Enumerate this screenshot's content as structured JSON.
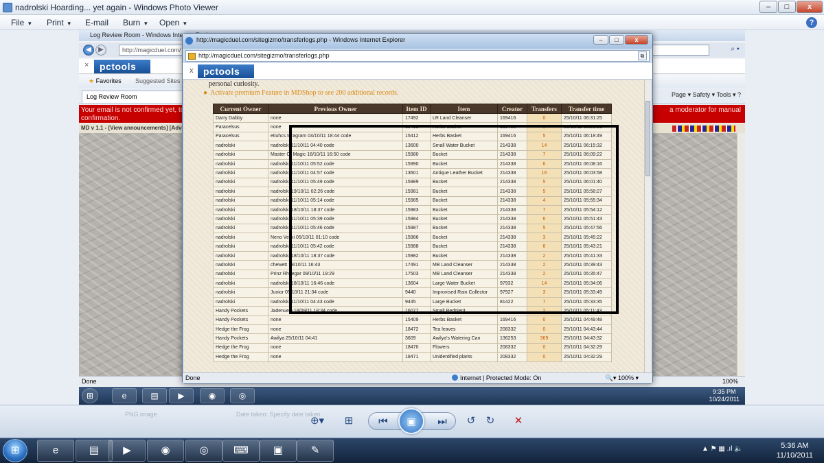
{
  "viewer": {
    "title": "nadrolski Hoarding... yet again - Windows Photo Viewer",
    "minimize": "–",
    "maximize": "□",
    "close": "x",
    "menu": [
      {
        "label": "File",
        "caret": "▼"
      },
      {
        "label": "Print",
        "caret": "▼"
      },
      {
        "label": "E-mail",
        "caret": ""
      },
      {
        "label": "Burn",
        "caret": "▼"
      },
      {
        "label": "Open",
        "caret": "▼"
      }
    ],
    "help": "?",
    "toolbar": {
      "zoom": "⊕▾",
      "fit": "⊞",
      "prev": "⏮",
      "slideshow": "▣",
      "next": "⏭",
      "rotate_left": "↺",
      "rotate_right": "↻",
      "delete": "✕",
      "ghost_left": "PNG image",
      "ghost_right": "Date taken: Specify date taken"
    }
  },
  "bg_ie": {
    "title": "Log Review Room - Windows Internet Explorer",
    "address": "http://magicduel.com/",
    "pct_label": "pctools",
    "favorites": "Favorites",
    "suggested": "Suggested Sites",
    "tab": "Log Review Room",
    "tools": "Page ▾   Safety ▾   Tools ▾   ?",
    "banner_left": "Your email is not confirmed yet, to",
    "banner_left2": "confirmation.",
    "banner_right": "a moderator for manual",
    "md_bar": "MD v 1.1 - [View announcements] [Adve",
    "status": "Done",
    "zoom": "100%",
    "clock_time": "9:35 PM",
    "clock_date": "10/24/2011"
  },
  "popup": {
    "title": "http://magicduel.com/sitegizmo/transferlogs.php - Windows Internet Explorer",
    "address": "http://magicduel.com/sitegizmo/transferlogs.php",
    "pct_label": "pctools",
    "close_tab": "x",
    "curiosity": "personal curiosity.",
    "promo": "Activate premium Feature in MDShop to see 200 additional records.",
    "status": "Done",
    "mode": "Internet | Protected Mode: On",
    "zoom": "100%"
  },
  "table": {
    "headers": [
      "Current Owner",
      "Previous Owner",
      "Item ID",
      "Item",
      "Creator",
      "Transfers",
      "Transfer time"
    ],
    "rows": [
      [
        "Darry Dabby",
        "none",
        "17492",
        "LR Land Cleanser",
        "169416",
        "0",
        "25/10/11 06:31:25"
      ],
      [
        "Paracelsus",
        "none",
        "15413",
        "Herbs Basket",
        "169416",
        "0",
        "25/10/11 06:20:31"
      ],
      [
        "Paracelsus",
        "etiuhcs teragram 04/10/11 18:44 code",
        "15412",
        "Herbs Basket",
        "169416",
        "5",
        "25/10/11 06:18:49"
      ],
      [
        "nadrolski",
        "nadrolski 11/10/11 04:40 code",
        "13600",
        "Small Water Bucket",
        "214338",
        "14",
        "25/10/11 06:15:32"
      ],
      [
        "nadrolski",
        "Master Of Magic 18/10/11 16:50 code",
        "15980",
        "Bucket",
        "214338",
        "7",
        "25/10/11 06:09:22"
      ],
      [
        "nadrolski",
        "nadrolski 11/10/11 05:52 code",
        "15990",
        "Bucket",
        "214338",
        "6",
        "25/10/11 06:08:16"
      ],
      [
        "nadrolski",
        "nadrolski 11/10/11 04:57 code",
        "13601",
        "Antique Leather Bucket",
        "214338",
        "16",
        "25/10/11 06:03:58"
      ],
      [
        "nadrolski",
        "nadrolski 11/10/11 05:49 code",
        "15989",
        "Bucket",
        "214338",
        "5",
        "25/10/11 06:01:40"
      ],
      [
        "nadrolski",
        "nadrolski 19/10/11 02:26 code",
        "15981",
        "Bucket",
        "214338",
        "5",
        "25/10/11 05:58:27"
      ],
      [
        "nadrolski",
        "nadrolski 11/10/11 05:14 code",
        "15985",
        "Bucket",
        "214338",
        "4",
        "25/10/11 05:55:34"
      ],
      [
        "nadrolski",
        "nadrolski 18/10/11 18:37 code",
        "15983",
        "Bucket",
        "214338",
        "7",
        "25/10/11 05:54:12"
      ],
      [
        "nadrolski",
        "nadrolski 11/10/11 05:39 code",
        "15984",
        "Bucket",
        "214338",
        "6",
        "25/10/11 05:51:43"
      ],
      [
        "nadrolski",
        "nadrolski 11/10/11 05:46 code",
        "15987",
        "Bucket",
        "214338",
        "5",
        "25/10/11 05:47:56"
      ],
      [
        "nadrolski",
        "Neno Veliki 05/10/11 01:10 code",
        "15986",
        "Bucket",
        "214338",
        "3",
        "25/10/11 05:45:22"
      ],
      [
        "nadrolski",
        "nadrolski 11/10/11 05:42 code",
        "15988",
        "Bucket",
        "214338",
        "6",
        "25/10/11 05:43:21"
      ],
      [
        "nadrolski",
        "nadrolski 18/10/11 18:37 code",
        "15982",
        "Bucket",
        "214338",
        "2",
        "25/10/11 05:41:33"
      ],
      [
        "nadrolski",
        "chewett 18/10/11 16:43",
        "17491",
        "MB Land Cleanser",
        "214338",
        "2",
        "25/10/11 05:39:43"
      ],
      [
        "nadrolski",
        "Prinz Rhaegar 09/10/11 19:29",
        "17503",
        "MB Land Cleanser",
        "214338",
        "2",
        "25/10/11 05:35:47"
      ],
      [
        "nadrolski",
        "nadrolski 18/10/11 16:46 code",
        "13604",
        "Large Water Bucket",
        "97932",
        "14",
        "25/10/11 05:34:06"
      ],
      [
        "nadrolski",
        "Junior 05/10/11 21:34 code",
        "9440",
        "Improvised Rain Collector",
        "97927",
        "3",
        "25/10/11 05:33:49"
      ],
      [
        "nadrolski",
        "nadrolski 11/10/11 04:43 code",
        "9445",
        "Large Bucket",
        "81422",
        "7",
        "25/10/11 05:33:35"
      ],
      [
        "Handy Pockets",
        "Jadenuew 18/09/11 18:34 code",
        "16077",
        "Small Redpient",
        "",
        "2",
        "25/10/11 05:11:43"
      ],
      [
        "Handy Pockets",
        "none",
        "15409",
        "Herbs Basket",
        "169416",
        "0",
        "25/10/11 04:49:48"
      ],
      [
        "Hedge the Frog",
        "none",
        "18472",
        "Tea leaves",
        "208332",
        "0",
        "25/10/11 04:43:44"
      ],
      [
        "Handy Pockets",
        "Awilya 25/10/11 04:41",
        "3609",
        "Awilya's Watering Can",
        "136253",
        "369",
        "25/10/11 04:43:32"
      ],
      [
        "Hedge the Frog",
        "none",
        "18470",
        "Flowers",
        "208332",
        "0",
        "25/10/11 04:32:29"
      ],
      [
        "Hedge the Frog",
        "none",
        "18471",
        "Unidentified plants",
        "208332",
        "0",
        "25/10/11 04:32:29"
      ]
    ]
  },
  "taskbar": {
    "start": "⊞",
    "apps": [
      {
        "name": "internet-explorer",
        "glyph": "e"
      },
      {
        "name": "file-explorer",
        "glyph": "▤"
      },
      {
        "name": "media-player",
        "glyph": "▶"
      },
      {
        "name": "firefox",
        "glyph": "◉"
      },
      {
        "name": "chrome",
        "glyph": "◎"
      },
      {
        "name": "keyboard",
        "glyph": "⌨"
      },
      {
        "name": "photo-viewer",
        "glyph": "▣"
      },
      {
        "name": "paint",
        "glyph": "✎"
      }
    ],
    "tray": "▲  ⚑  ▦  .ıl  🔈",
    "clock_time": "5:36 AM",
    "clock_date": "11/10/2011"
  }
}
